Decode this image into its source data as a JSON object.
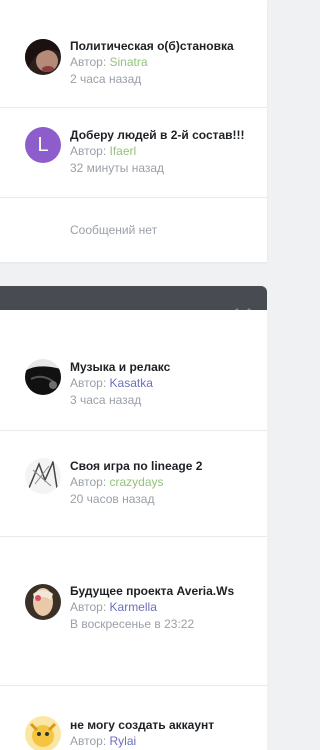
{
  "colors": {
    "green_author": "#94c27b",
    "blue_author": "#6b6fbf",
    "header_bg": "#494b52",
    "letter_avatar_bg": "#8d5ecb"
  },
  "author_prefix": "Автор:",
  "group1": {
    "topics": [
      {
        "title": "Политическая о(б)становка",
        "author": "Sinatra",
        "time": "2 часа назад",
        "author_color": "green",
        "avatar": "photo-dark"
      },
      {
        "title": "Доберу людей в 2-й состав!!!",
        "author": "Ifaerl",
        "time": "32 минуты назад",
        "author_color": "green",
        "avatar": "letter",
        "avatar_letter": "L"
      }
    ],
    "empty_message": "Сообщений нет"
  },
  "group2": {
    "header_icon": "chevron-down-icon",
    "topics": [
      {
        "title": "Музыка и релакс",
        "author": "Kasatka",
        "time": "3 часа назад",
        "author_color": "blue",
        "avatar": "photo-hair"
      },
      {
        "title": "Своя игра по lineage 2",
        "author": "crazydays",
        "time": "20 часов назад",
        "author_color": "green",
        "avatar": "photo-sketch"
      },
      {
        "title": "Будущее проекта Averia.Ws",
        "author": "Karmella",
        "time": "В воскресенье в 23:22",
        "author_color": "blue",
        "avatar": "photo-angel"
      },
      {
        "title": "не могу создать аккаунт",
        "author": "Rylai",
        "time": "",
        "author_color": "blue",
        "avatar": "photo-cartoon"
      }
    ]
  }
}
